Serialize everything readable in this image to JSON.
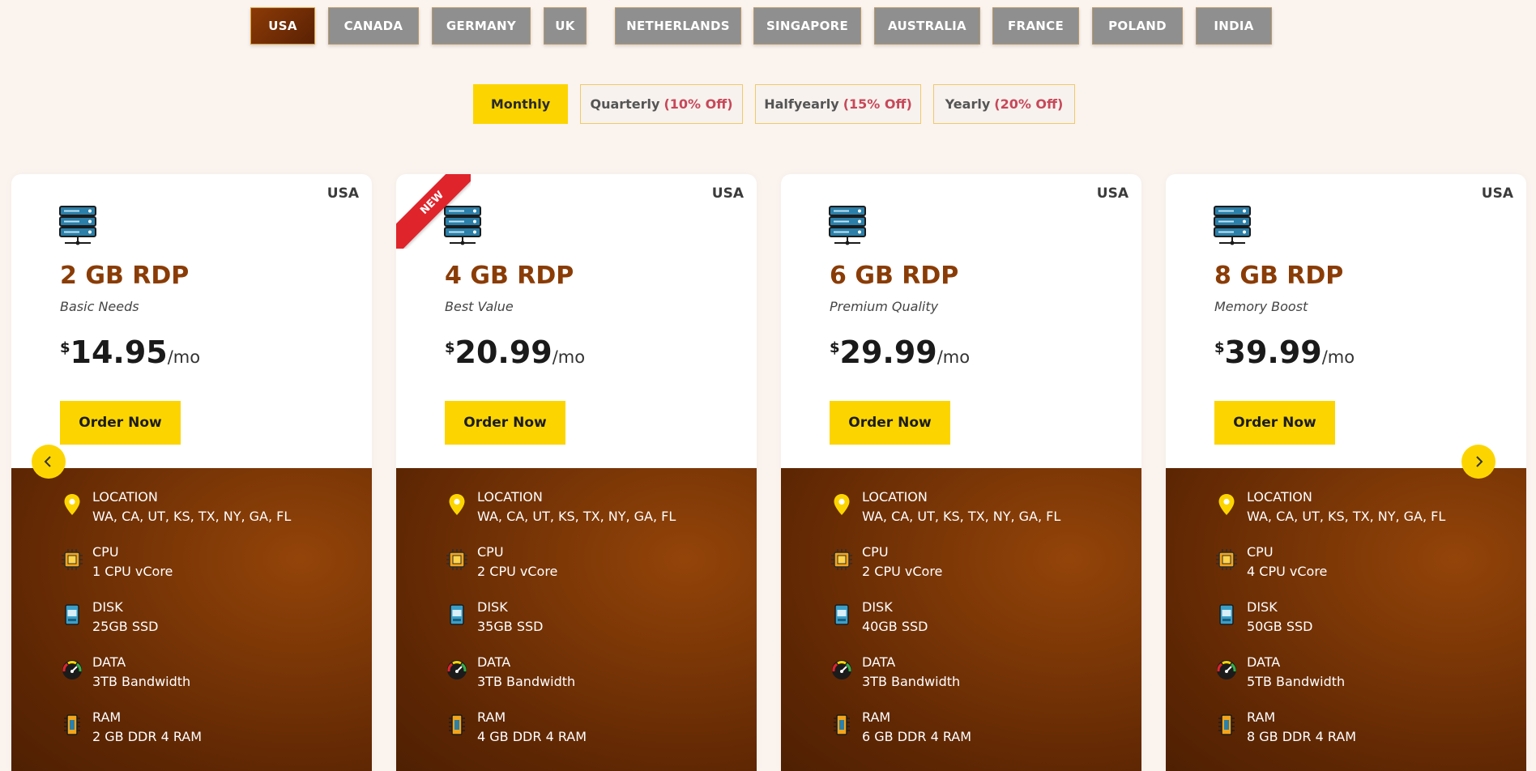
{
  "countries": [
    "USA",
    "CANADA",
    "GERMANY",
    "UK",
    "NETHERLANDS",
    "SINGAPORE",
    "AUSTRALIA",
    "FRANCE",
    "POLAND",
    "INDIA"
  ],
  "active_country": "USA",
  "billing": [
    {
      "label": "Monthly",
      "discount": ""
    },
    {
      "label": "Quarterly",
      "discount": "(10% Off)"
    },
    {
      "label": "Halfyearly",
      "discount": "(15% Off)"
    },
    {
      "label": "Yearly",
      "discount": "(20% Off)"
    }
  ],
  "active_billing": "Monthly",
  "colors": {
    "accent": "#fcd500",
    "brand": "#8a3c06",
    "ribbon": "#e0242c",
    "discount": "#c7485a"
  },
  "plans": [
    {
      "country": "USA",
      "name": "2 GB RDP",
      "tagline": "Basic Needs",
      "currency": "$",
      "price": "14.95",
      "period": "/mo",
      "order_label": "Order Now",
      "ribbon": "",
      "specs": [
        {
          "icon": "location-pin-icon",
          "label": "LOCATION",
          "value": "WA, CA, UT, KS, TX, NY, GA, FL"
        },
        {
          "icon": "cpu-chip-icon",
          "label": "CPU",
          "value": "1 CPU vCore"
        },
        {
          "icon": "ssd-disk-icon",
          "label": "DISK",
          "value": "25GB SSD"
        },
        {
          "icon": "speedometer-icon",
          "label": "DATA",
          "value": "3TB Bandwidth"
        },
        {
          "icon": "ram-module-icon",
          "label": "RAM",
          "value": "2 GB DDR 4 RAM"
        }
      ]
    },
    {
      "country": "USA",
      "name": "4 GB RDP",
      "tagline": "Best Value",
      "currency": "$",
      "price": "20.99",
      "period": "/mo",
      "order_label": "Order Now",
      "ribbon": "NEW",
      "specs": [
        {
          "icon": "location-pin-icon",
          "label": "LOCATION",
          "value": "WA, CA, UT, KS, TX, NY, GA, FL"
        },
        {
          "icon": "cpu-chip-icon",
          "label": "CPU",
          "value": "2 CPU vCore"
        },
        {
          "icon": "ssd-disk-icon",
          "label": "DISK",
          "value": "35GB SSD"
        },
        {
          "icon": "speedometer-icon",
          "label": "DATA",
          "value": "3TB Bandwidth"
        },
        {
          "icon": "ram-module-icon",
          "label": "RAM",
          "value": "4 GB DDR 4 RAM"
        }
      ]
    },
    {
      "country": "USA",
      "name": "6 GB RDP",
      "tagline": "Premium Quality",
      "currency": "$",
      "price": "29.99",
      "period": "/mo",
      "order_label": "Order Now",
      "ribbon": "",
      "specs": [
        {
          "icon": "location-pin-icon",
          "label": "LOCATION",
          "value": "WA, CA, UT, KS, TX, NY, GA, FL"
        },
        {
          "icon": "cpu-chip-icon",
          "label": "CPU",
          "value": "2 CPU vCore"
        },
        {
          "icon": "ssd-disk-icon",
          "label": "DISK",
          "value": "40GB SSD"
        },
        {
          "icon": "speedometer-icon",
          "label": "DATA",
          "value": "3TB Bandwidth"
        },
        {
          "icon": "ram-module-icon",
          "label": "RAM",
          "value": "6 GB DDR 4 RAM"
        }
      ]
    },
    {
      "country": "USA",
      "name": "8 GB RDP",
      "tagline": "Memory Boost",
      "currency": "$",
      "price": "39.99",
      "period": "/mo",
      "order_label": "Order Now",
      "ribbon": "",
      "specs": [
        {
          "icon": "location-pin-icon",
          "label": "LOCATION",
          "value": "WA, CA, UT, KS, TX, NY, GA, FL"
        },
        {
          "icon": "cpu-chip-icon",
          "label": "CPU",
          "value": "4 CPU vCore"
        },
        {
          "icon": "ssd-disk-icon",
          "label": "DISK",
          "value": "50GB SSD"
        },
        {
          "icon": "speedometer-icon",
          "label": "DATA",
          "value": "5TB Bandwidth"
        },
        {
          "icon": "ram-module-icon",
          "label": "RAM",
          "value": "8 GB DDR 4 RAM"
        }
      ]
    }
  ]
}
